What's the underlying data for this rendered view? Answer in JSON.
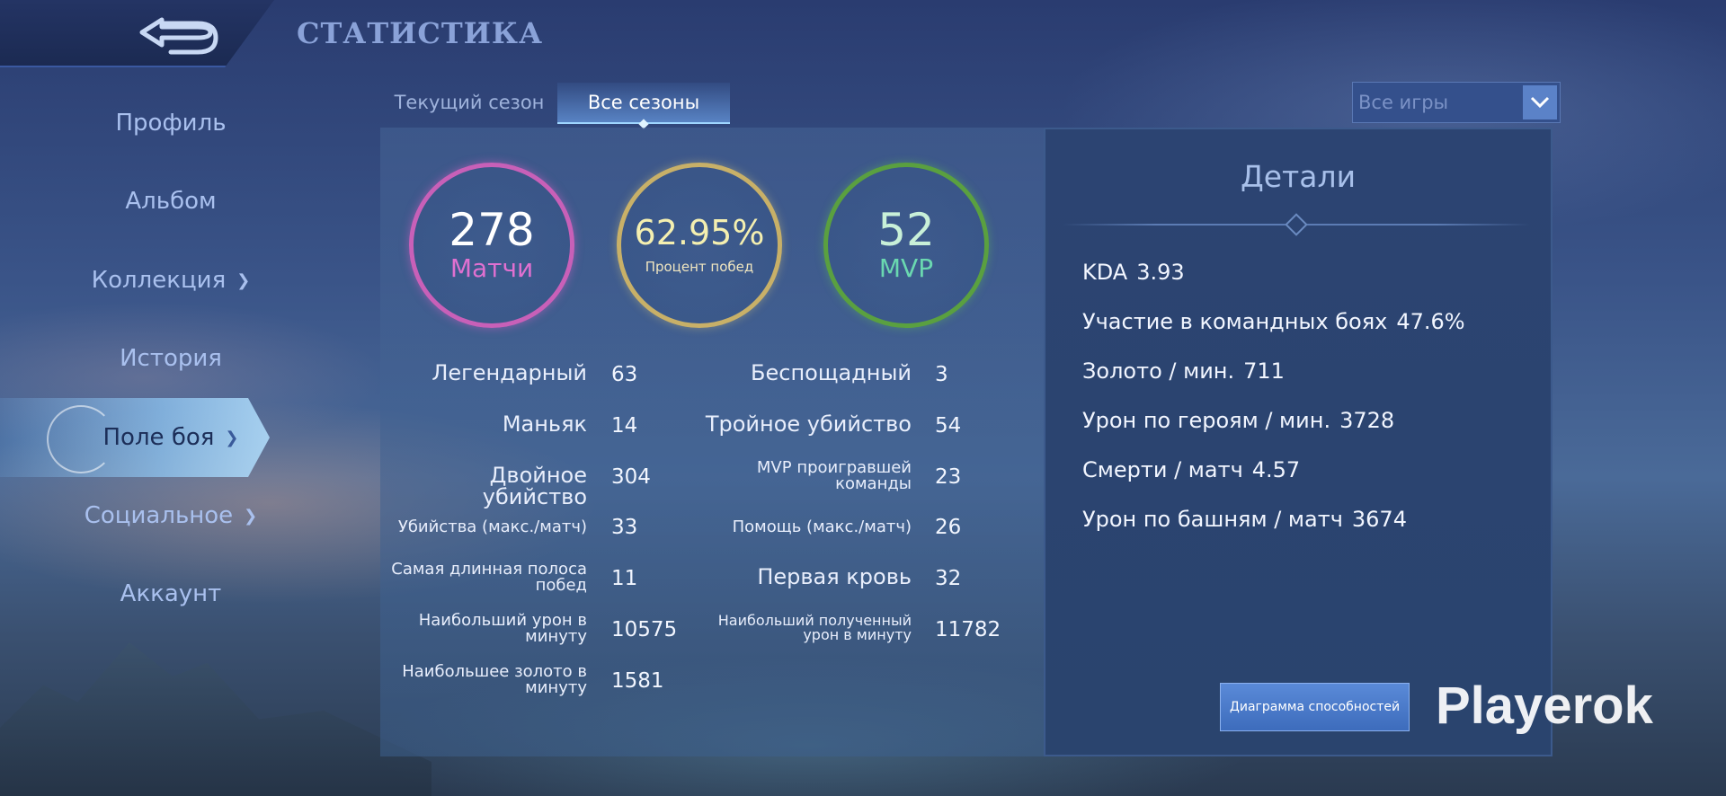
{
  "header": {
    "title": "СТАТИСТИКА",
    "back_icon": "back-arrow-icon"
  },
  "sidebar": {
    "items": [
      {
        "label": "Профиль",
        "has_chevron": false,
        "active": false
      },
      {
        "label": "Альбом",
        "has_chevron": false,
        "active": false
      },
      {
        "label": "Коллекция",
        "has_chevron": true,
        "active": false
      },
      {
        "label": "История",
        "has_chevron": false,
        "active": false
      },
      {
        "label": "Поле боя",
        "has_chevron": true,
        "active": true
      },
      {
        "label": "Социальное",
        "has_chevron": true,
        "active": false
      },
      {
        "label": "Аккаунт",
        "has_chevron": false,
        "active": false
      }
    ]
  },
  "tabs": [
    {
      "label": "Текущий сезон",
      "active": false
    },
    {
      "label": "Все сезоны",
      "active": true
    }
  ],
  "filter": {
    "selected": "Все игры"
  },
  "summary": {
    "matches": {
      "value": "278",
      "caption": "Матчи"
    },
    "winrate": {
      "value": "62.95%",
      "caption": "Процент побед"
    },
    "mvp": {
      "value": "52",
      "caption": "MVP"
    }
  },
  "stats_left": [
    {
      "label": "Легендарный",
      "value": "63"
    },
    {
      "label": "Маньяк",
      "value": "14"
    },
    {
      "label": "Двойное убийство",
      "value": "304"
    },
    {
      "label": "Убийства (макс./матч)",
      "value": "33"
    },
    {
      "label": "Самая длинная полоса побед",
      "value": "11"
    },
    {
      "label": "Наибольший урон в минуту",
      "value": "10575"
    },
    {
      "label": "Наибольшее золото в минуту",
      "value": "1581"
    }
  ],
  "stats_right": [
    {
      "label": "Беспощадный",
      "value": "3"
    },
    {
      "label": "Тройное убийство",
      "value": "54"
    },
    {
      "label": "MVP проигравшей команды",
      "value": "23"
    },
    {
      "label": "Помощь (макс./матч)",
      "value": "26"
    },
    {
      "label": "Первая кровь",
      "value": "32"
    },
    {
      "label": "Наибольший полученный урон в минуту",
      "value": "11782"
    }
  ],
  "details": {
    "title": "Детали",
    "rows": [
      {
        "label": "KDA",
        "value": "3.93"
      },
      {
        "label": "Участие в командных боях",
        "value": "47.6%"
      },
      {
        "label": "Золото / мин.",
        "value": "711"
      },
      {
        "label": "Урон по героям / мин.",
        "value": "3728"
      },
      {
        "label": "Смерти / матч",
        "value": "4.57"
      },
      {
        "label": "Урон по башням / матч",
        "value": "3674"
      }
    ],
    "button": "Диаграмма способностей"
  },
  "watermark": "Playerok"
}
